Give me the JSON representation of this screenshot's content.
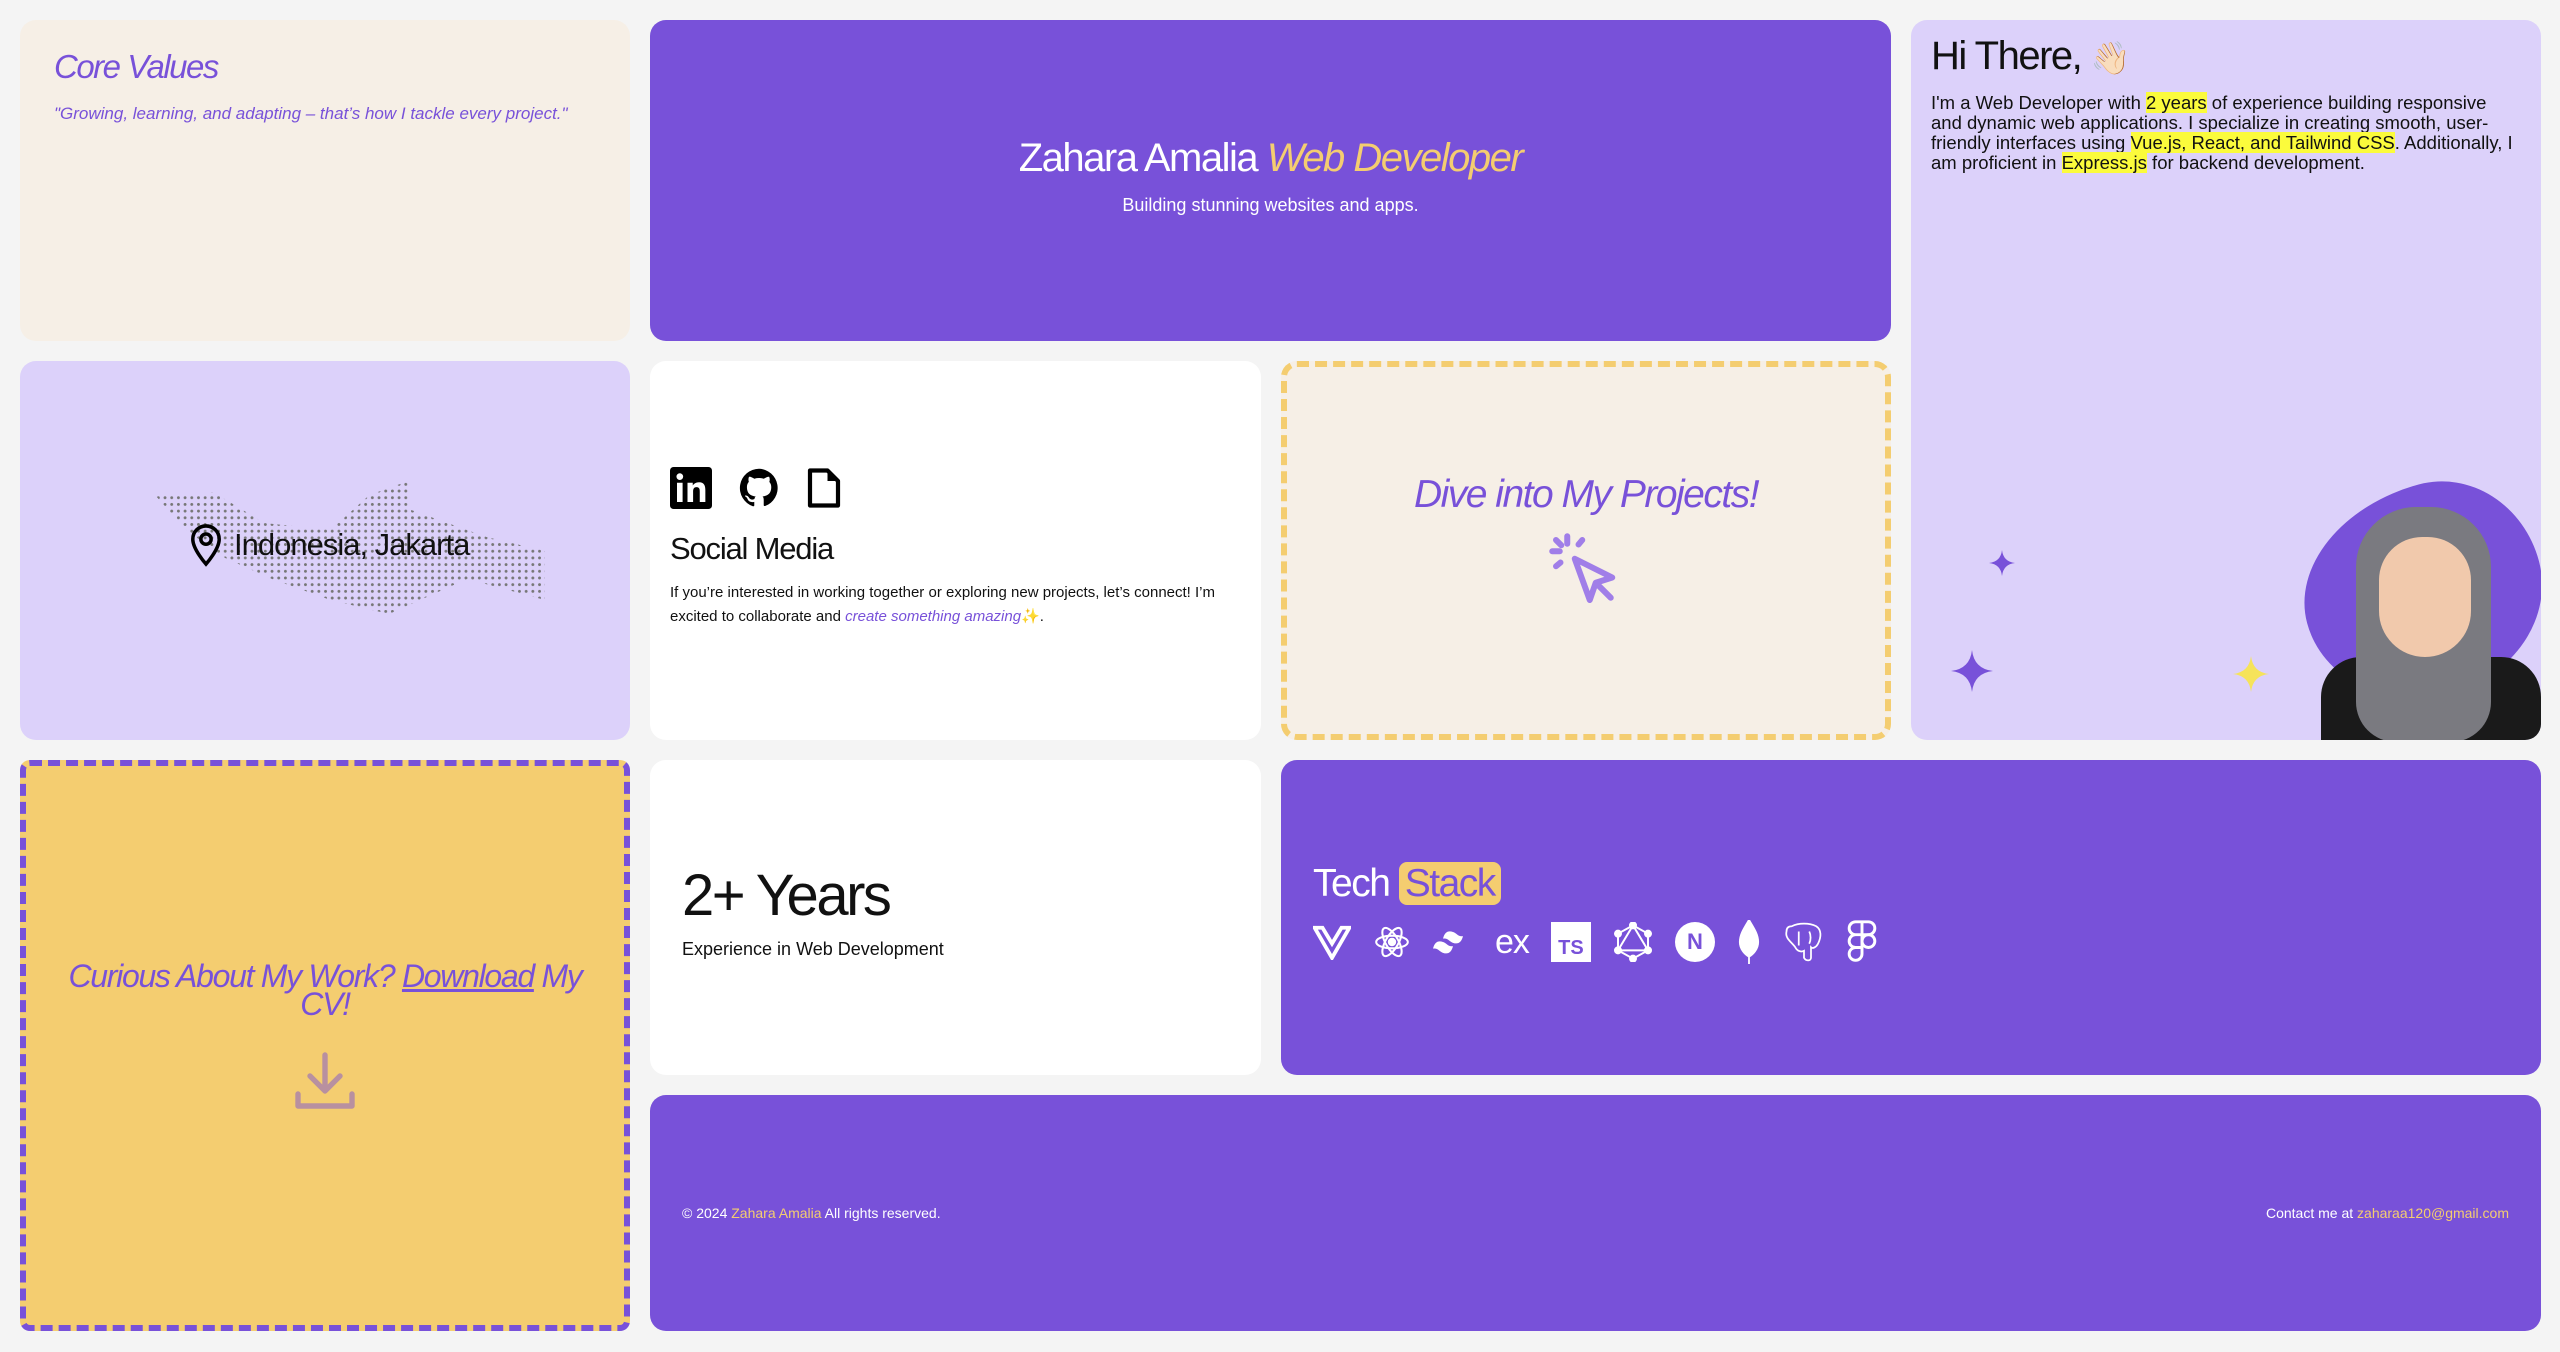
{
  "core_values": {
    "title": "Core Values",
    "quote": "\"Growing, learning, and adapting – that’s how I tackle every project.\""
  },
  "hero": {
    "name": "Zahara Amalia",
    "role": "Web Developer",
    "subtitle": "Building stunning websites and apps."
  },
  "about": {
    "greeting": "Hi There,",
    "wave": "👋🏻",
    "t1": "I'm a Web Developer with ",
    "h1": "2 years",
    "t2": " of experience building responsive and dynamic web applications. I specialize in creating smooth, user-friendly interfaces using ",
    "h2": "Vue.js, React, and Tailwind CSS",
    "t3": ". Additionally, I am proficient in ",
    "h3": "Express.js",
    "t4": " for backend development."
  },
  "location": {
    "label": "Indonesia, Jakarta"
  },
  "social": {
    "title": "Social Media",
    "t1": "If you’re interested in working together or exploring new projects, let’s connect! I’m excited to collaborate and ",
    "link": "create something amazing",
    "sparkle": "✨",
    "t2": ".",
    "icons": [
      "linkedin-icon",
      "github-icon",
      "file-icon"
    ]
  },
  "projects": {
    "title": "Dive into My Projects!"
  },
  "cv": {
    "t1": "Curious About My Work? ",
    "link": "Download",
    "t2": " My CV!"
  },
  "years": {
    "value": "2+ Years",
    "label": "Experience in Web Development"
  },
  "tech": {
    "w1": "Tech",
    "w2": "Stack",
    "icons": [
      "vue-icon",
      "react-icon",
      "tailwind-icon",
      "express-icon",
      "typescript-icon",
      "graphql-icon",
      "nextjs-icon",
      "mongodb-icon",
      "postgresql-icon",
      "figma-icon"
    ],
    "ex": "ex",
    "ts": "TS",
    "n": "N"
  },
  "footer": {
    "copy": "© 2024 ",
    "name": "Zahara Amalia",
    "rights": " All rights reserved.",
    "contact": "Contact me at ",
    "email": "zaharaa120@gmail.com"
  },
  "colors": {
    "purple": "#7851d9",
    "lavender": "#dcd1fa",
    "cream": "#f6efe6",
    "yellow": "#f4cd70"
  }
}
